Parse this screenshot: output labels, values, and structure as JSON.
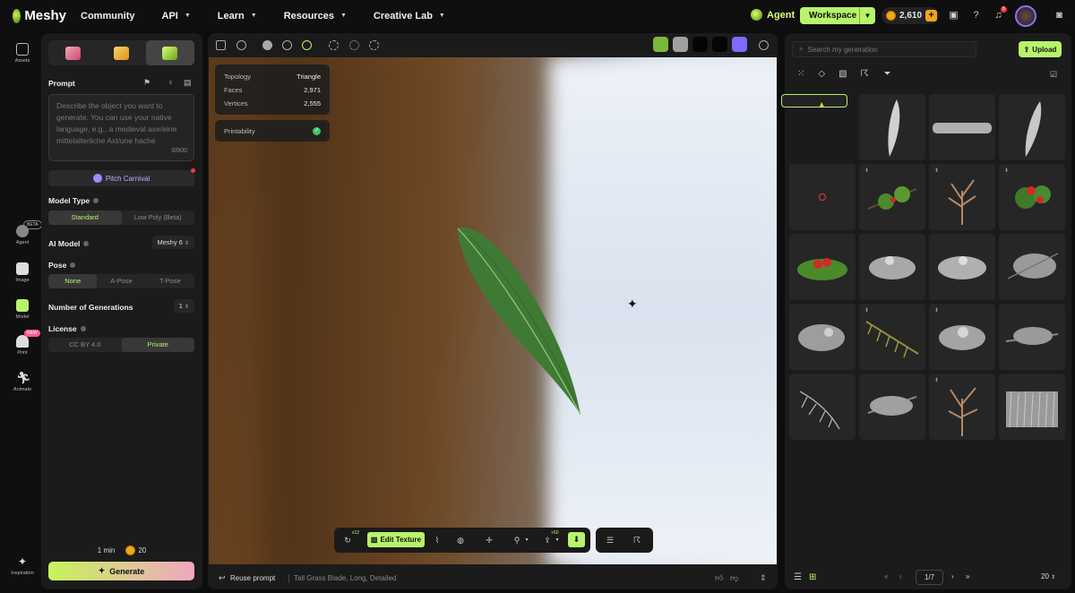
{
  "app": {
    "logo_text": "Meshy"
  },
  "nav": [
    {
      "label": "Community",
      "caret": false
    },
    {
      "label": "API",
      "caret": true
    },
    {
      "label": "Learn",
      "caret": true
    },
    {
      "label": "Resources",
      "caret": true
    },
    {
      "label": "Creative Lab",
      "caret": true
    }
  ],
  "topbar": {
    "agent_label": "Agent",
    "workspace_label": "Workspace",
    "credits": "2,610",
    "notification_count": "5"
  },
  "rail": {
    "assets": "Assets",
    "agent": "Agent",
    "agent_tag": "BETA",
    "image": "Image",
    "model": "Model",
    "print": "Print",
    "print_tag": "NEW",
    "animate": "Animate",
    "inspiration": "Inspiration"
  },
  "panel": {
    "prompt_label": "Prompt",
    "prompt_placeholder": "Describe the object you want to generate. You can use your native language, e.g., a medieval axe/eine mittelalterliche Axt/une hache",
    "prompt_count": "0/800",
    "pitch_label": "Pitch Carnival",
    "model_type_label": "Model Type",
    "model_type_options": [
      "Standard",
      "Low Poly (Beta)"
    ],
    "ai_model_label": "AI Model",
    "ai_model_value": "Meshy 6",
    "pose_label": "Pose",
    "pose_options": [
      "None",
      "A-Pose",
      "T-Pose"
    ],
    "num_gen_label": "Number of Generations",
    "num_gen_value": "1",
    "license_label": "License",
    "license_options": [
      "CC BY 4.0",
      "Private"
    ],
    "time": "1 min",
    "cost": "20",
    "generate_label": "Generate"
  },
  "viewport": {
    "swatch_colors": [
      "#7ab93a",
      "#a0a0a0",
      "#050505",
      "#050505",
      "#7b6bff"
    ],
    "info": [
      {
        "k": "Topology",
        "v": "Triangle"
      },
      {
        "k": "Faces",
        "v": "2,971"
      },
      {
        "k": "Vertices",
        "v": "2,555"
      }
    ],
    "printability_label": "Printability",
    "retry_badge": "x12",
    "edit_texture_label": "Edit Texture",
    "share_badge": "+50",
    "reuse_prompt_label": "Reuse prompt",
    "prompt_text": "Tall Grass Blade, Long, Detailed"
  },
  "right": {
    "search_placeholder": "Search my generation",
    "upload_label": "Upload",
    "page": "1/7",
    "page_size": "20"
  }
}
